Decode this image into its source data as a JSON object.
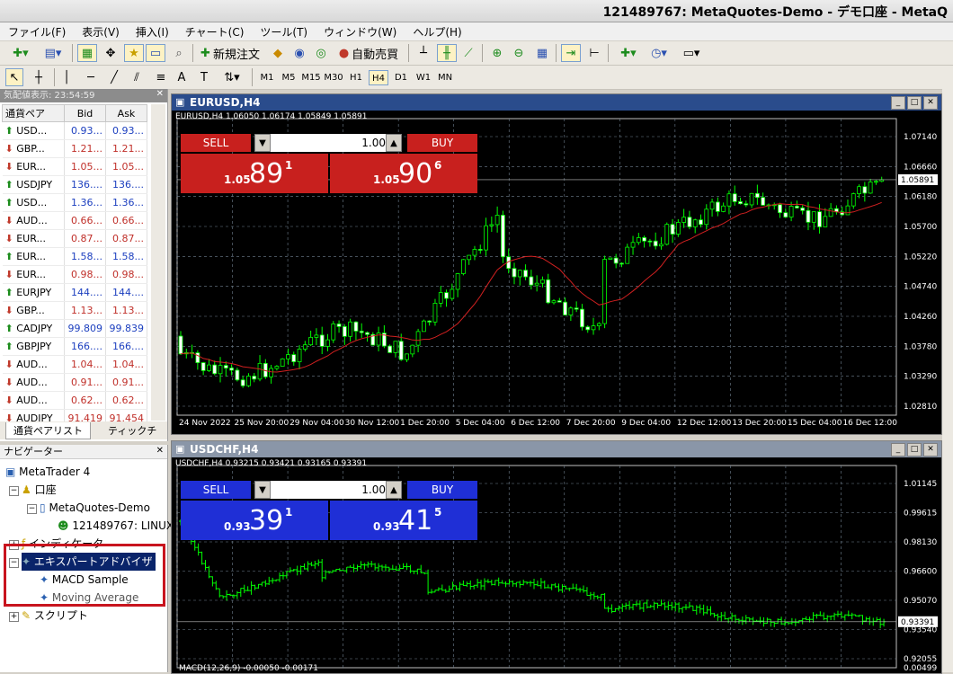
{
  "window_title": "121489767: MetaQuotes-Demo - デモ口座 - MetaQ",
  "menu": [
    "ファイル(F)",
    "表示(V)",
    "挿入(I)",
    "チャート(C)",
    "ツール(T)",
    "ウィンドウ(W)",
    "ヘルプ(H)"
  ],
  "toolbar": {
    "new_order": "新規注文",
    "auto_trade": "自動売買",
    "A": "A"
  },
  "timeframes": [
    "M1",
    "M5",
    "M15",
    "M30",
    "H1",
    "H4",
    "D1",
    "W1",
    "MN"
  ],
  "selected_timeframe": "H4",
  "market_watch": {
    "header": "気配値表示: 23:54:59",
    "col_symbol": "通貨ペア",
    "col_bid": "Bid",
    "col_ask": "Ask",
    "rows": [
      {
        "symbol": "USD...",
        "bid": "0.93...",
        "ask": "0.93...",
        "dir": "up",
        "color": "blue"
      },
      {
        "symbol": "GBP...",
        "bid": "1.21...",
        "ask": "1.21...",
        "dir": "down",
        "color": "red"
      },
      {
        "symbol": "EUR...",
        "bid": "1.05...",
        "ask": "1.05...",
        "dir": "down",
        "color": "red"
      },
      {
        "symbol": "USDJPY",
        "bid": "136....",
        "ask": "136....",
        "dir": "up",
        "color": "blue"
      },
      {
        "symbol": "USD...",
        "bid": "1.36...",
        "ask": "1.36...",
        "dir": "up",
        "color": "blue"
      },
      {
        "symbol": "AUD...",
        "bid": "0.66...",
        "ask": "0.66...",
        "dir": "down",
        "color": "red"
      },
      {
        "symbol": "EUR...",
        "bid": "0.87...",
        "ask": "0.87...",
        "dir": "down",
        "color": "red"
      },
      {
        "symbol": "EUR...",
        "bid": "1.58...",
        "ask": "1.58...",
        "dir": "up",
        "color": "blue"
      },
      {
        "symbol": "EUR...",
        "bid": "0.98...",
        "ask": "0.98...",
        "dir": "down",
        "color": "red"
      },
      {
        "symbol": "EURJPY",
        "bid": "144....",
        "ask": "144....",
        "dir": "up",
        "color": "blue"
      },
      {
        "symbol": "GBP...",
        "bid": "1.13...",
        "ask": "1.13...",
        "dir": "down",
        "color": "red"
      },
      {
        "symbol": "CADJPY",
        "bid": "99.809",
        "ask": "99.839",
        "dir": "up",
        "color": "blue"
      },
      {
        "symbol": "GBPJPY",
        "bid": "166....",
        "ask": "166....",
        "dir": "up",
        "color": "blue"
      },
      {
        "symbol": "AUD...",
        "bid": "1.04...",
        "ask": "1.04...",
        "dir": "down",
        "color": "red"
      },
      {
        "symbol": "AUD...",
        "bid": "0.91...",
        "ask": "0.91...",
        "dir": "down",
        "color": "red"
      },
      {
        "symbol": "AUD...",
        "bid": "0.62...",
        "ask": "0.62...",
        "dir": "down",
        "color": "red"
      },
      {
        "symbol": "AUDJPY",
        "bid": "91.419",
        "ask": "91.454",
        "dir": "down",
        "color": "red"
      }
    ],
    "tab_symbols": "通貨ペアリスト",
    "tab_ticks": "ティックチ"
  },
  "navigator": {
    "header": "ナビゲーター",
    "root": "MetaTrader 4",
    "accounts": "口座",
    "server": "MetaQuotes-Demo",
    "account": "121489767: LINUX",
    "indicators": "インディケータ",
    "experts": "エキスパートアドバイザ",
    "expert_items": [
      "MACD Sample",
      "Moving Average"
    ],
    "scripts": "スクリプト"
  },
  "charts": [
    {
      "title": "EURUSD,H4",
      "info": "EURUSD,H4  1.06050 1.06174 1.05849 1.05891",
      "sell_label": "SELL",
      "buy_label": "BUY",
      "lot": "1.00",
      "sell_small": "1.05",
      "sell_big": "89",
      "sell_sup": "1",
      "buy_small": "1.05",
      "buy_big": "90",
      "buy_sup": "6",
      "button_color": "#c8201e",
      "price_axis": [
        "1.07140",
        "1.06660",
        "1.06180",
        "1.05700",
        "1.05220",
        "1.04740",
        "1.04260",
        "1.03780",
        "1.03290",
        "1.02810"
      ],
      "price_label": "1.05891",
      "time_axis": [
        "24 Nov 2022",
        "25 Nov 20:00",
        "29 Nov 04:00",
        "30 Nov 12:00",
        "1 Dec 20:00",
        "5 Dec 04:00",
        "6 Dec 12:00",
        "7 Dec 20:00",
        "9 Dec 04:00",
        "12 Dec 12:00",
        "13 Dec 20:00",
        "15 Dec 04:00",
        "16 Dec 12:00"
      ]
    },
    {
      "title": "USDCHF,H4",
      "info": "USDCHF,H4  0.93215 0.93421 0.93165 0.93391",
      "sell_label": "SELL",
      "buy_label": "BUY",
      "lot": "1.00",
      "sell_small": "0.93",
      "sell_big": "39",
      "sell_sup": "1",
      "buy_small": "0.93",
      "buy_big": "41",
      "buy_sup": "5",
      "button_color": "#1f2fd6",
      "price_axis": [
        "1.01145",
        "0.99615",
        "0.98130",
        "0.96600",
        "0.95070",
        "0.93540",
        "0.92055"
      ],
      "price_label": "0.93391",
      "macd_label": "MACD(12,26,9) -0.00050 -0.00171",
      "macd_axis": "0.00499"
    }
  ]
}
